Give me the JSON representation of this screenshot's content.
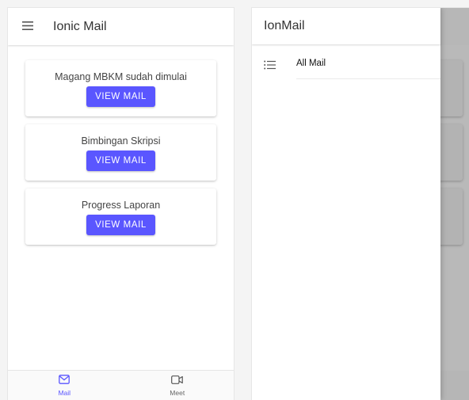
{
  "left_screen": {
    "toolbar": {
      "title": "Ionic Mail",
      "menu_icon": "menu-icon"
    },
    "cards": [
      {
        "title": "Magang MBKM sudah dimulai",
        "button_label": "VIEW MAIL"
      },
      {
        "title": "Bimbingan Skripsi",
        "button_label": "VIEW MAIL"
      },
      {
        "title": "Progress Laporan",
        "button_label": "VIEW MAIL"
      }
    ],
    "tabs": [
      {
        "label": "Mail",
        "icon": "mail-icon",
        "active": true
      },
      {
        "label": "Meet",
        "icon": "video-icon",
        "active": false
      }
    ]
  },
  "right_screen": {
    "drawer": {
      "title": "IonMail",
      "items": [
        {
          "label": "All Mail",
          "icon": "list-icon"
        }
      ]
    }
  },
  "colors": {
    "accent": "#5a56ff",
    "backdrop": "#b9b9b9",
    "surface": "#ffffff"
  }
}
